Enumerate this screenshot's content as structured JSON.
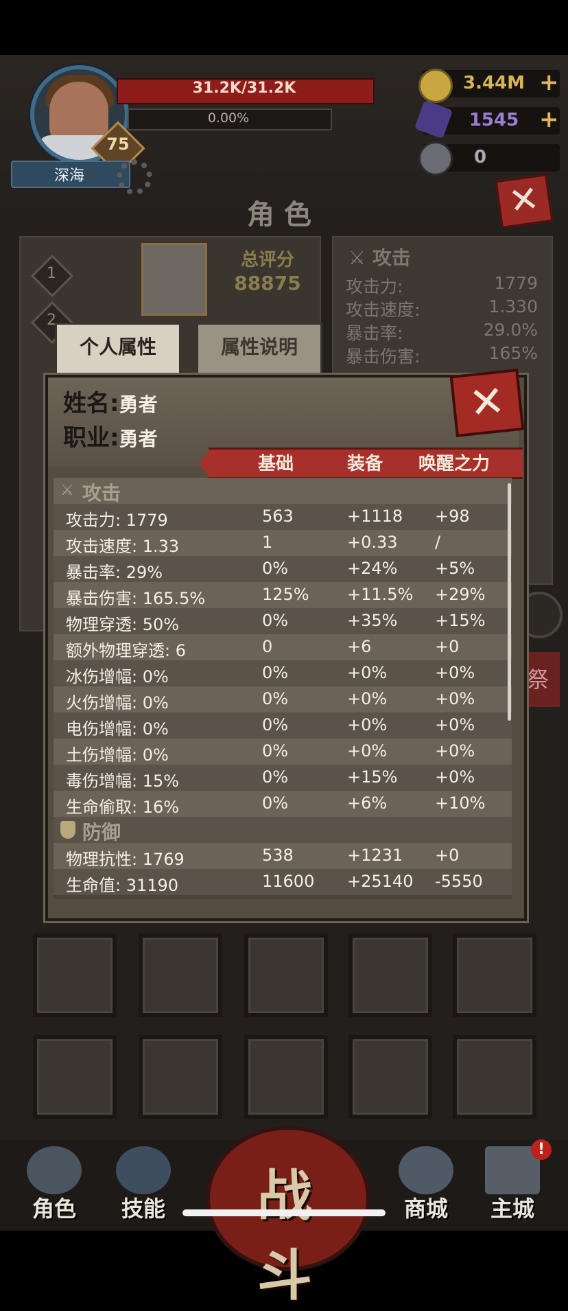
{
  "player": {
    "name": "深海",
    "level": "75",
    "hp_text": "31.2K/31.2K",
    "xp_text": "0.00%"
  },
  "currencies": [
    {
      "value": "3.44M",
      "icon": "gold-coin-icon",
      "color": "#d6b558"
    },
    {
      "value": "1545",
      "icon": "purple-crystal-icon",
      "color": "#9b7fd6"
    },
    {
      "value": "0",
      "icon": "ram-skull-icon",
      "color": "#a9a9b5"
    }
  ],
  "plus_symbol": "+",
  "page_title": "角色",
  "background_panel": {
    "score_label": "总评分",
    "score_value": "88875",
    "slot_numbers": [
      "1",
      "2"
    ],
    "attack_title": "攻击",
    "attack_stats": [
      {
        "label": "攻击力:",
        "value": "1779"
      },
      {
        "label": "攻击速度:",
        "value": "1.330"
      },
      {
        "label": "暴击率:",
        "value": "29.0%"
      },
      {
        "label": "暴击伤害:",
        "value": "165%"
      }
    ],
    "side_label": "祭"
  },
  "tabs": {
    "personal": "个人属性",
    "description": "属性说明"
  },
  "modal": {
    "name_label": "姓名:",
    "name_value": "勇者",
    "class_label": "职业:",
    "class_value": "勇者",
    "columns": [
      "基础",
      "装备",
      "唤醒之力"
    ],
    "close_symbol": "✕",
    "sections": [
      {
        "title": "攻击",
        "rows": [
          {
            "stat": "攻击力: 1779",
            "base": "563",
            "equip": "+1118",
            "awaken": "+98"
          },
          {
            "stat": "攻击速度: 1.33",
            "base": "1",
            "equip": "+0.33",
            "awaken": "/"
          },
          {
            "stat": "暴击率: 29%",
            "base": "0%",
            "equip": "+24%",
            "awaken": "+5%"
          },
          {
            "stat": "暴击伤害: 165.5%",
            "base": "125%",
            "equip": "+11.5%",
            "awaken": "+29%"
          },
          {
            "stat": "物理穿透: 50%",
            "base": "0%",
            "equip": "+35%",
            "awaken": "+15%"
          },
          {
            "stat": "额外物理穿透: 6",
            "base": "0",
            "equip": "+6",
            "awaken": "+0"
          },
          {
            "stat": "冰伤增幅: 0%",
            "base": "0%",
            "equip": "+0%",
            "awaken": "+0%"
          },
          {
            "stat": "火伤增幅: 0%",
            "base": "0%",
            "equip": "+0%",
            "awaken": "+0%"
          },
          {
            "stat": "电伤增幅: 0%",
            "base": "0%",
            "equip": "+0%",
            "awaken": "+0%"
          },
          {
            "stat": "土伤增幅: 0%",
            "base": "0%",
            "equip": "+0%",
            "awaken": "+0%"
          },
          {
            "stat": "毒伤增幅: 15%",
            "base": "0%",
            "equip": "+15%",
            "awaken": "+0%"
          },
          {
            "stat": "生命偷取: 16%",
            "base": "0%",
            "equip": "+6%",
            "awaken": "+10%"
          }
        ]
      },
      {
        "title": "防御",
        "rows": [
          {
            "stat": "物理抗性: 1769",
            "base": "538",
            "equip": "+1231",
            "awaken": "+0"
          },
          {
            "stat": "生命值: 31190",
            "base": "11600",
            "equip": "+25140",
            "awaken": "-5550"
          }
        ]
      }
    ]
  },
  "bottom_nav": {
    "items": [
      "角色",
      "技能",
      "商城",
      "主城"
    ],
    "battle": "战斗",
    "notification": "!"
  }
}
